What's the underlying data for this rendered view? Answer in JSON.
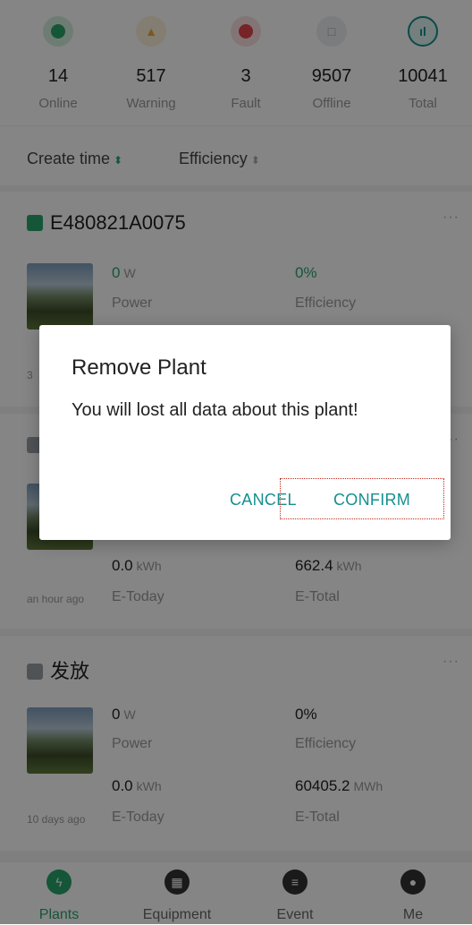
{
  "stats": [
    {
      "value": "14",
      "label": "Online",
      "icon": "check-circle-icon",
      "color": "#2aa56b",
      "glyph": "✓"
    },
    {
      "value": "517",
      "label": "Warning",
      "icon": "warning-triangle-icon",
      "color": "#f2a63a",
      "glyph": "▲"
    },
    {
      "value": "3",
      "label": "Fault",
      "icon": "fault-x-icon",
      "color": "#e2464d",
      "glyph": "✕"
    },
    {
      "value": "9507",
      "label": "Offline",
      "icon": "offline-icon",
      "color": "#9aa0a6",
      "glyph": "□"
    },
    {
      "value": "10041",
      "label": "Total",
      "icon": "chart-icon",
      "color": "#14908f",
      "glyph": "ıl"
    }
  ],
  "sort": {
    "create_time": "Create time",
    "efficiency": "Efficiency",
    "create_time_arrow": "⬍",
    "efficiency_arrow": "⬍"
  },
  "plants": [
    {
      "name": "E480821A0075",
      "more": "···",
      "power_value": "0",
      "power_unit": "W",
      "power_label": "Power",
      "efficiency_value": "0%",
      "efficiency_label": "Efficiency",
      "ago": "3"
    },
    {
      "name": "",
      "more": "···",
      "etoday_value": "0.0",
      "etoday_unit": "kWh",
      "etoday_label": "E-Today",
      "etotal_value": "662.4",
      "etotal_unit": "kWh",
      "etotal_label": "E-Total",
      "ago": "an hour ago"
    },
    {
      "name": "发放",
      "more": "···",
      "power_value": "0",
      "power_unit": "W",
      "power_label": "Power",
      "efficiency_value": "0%",
      "efficiency_label": "Efficiency",
      "etoday_value": "0.0",
      "etoday_unit": "kWh",
      "etoday_label": "E-Today",
      "etotal_value": "60405.2",
      "etotal_unit": "MWh",
      "etotal_label": "E-Total",
      "ago": "10 days ago"
    }
  ],
  "tabs": [
    {
      "label": "Plants",
      "icon": "lightning-icon",
      "glyph": "ϟ"
    },
    {
      "label": "Equipment",
      "icon": "solar-panel-icon",
      "glyph": "▦"
    },
    {
      "label": "Event",
      "icon": "clipboard-icon",
      "glyph": "≡"
    },
    {
      "label": "Me",
      "icon": "user-icon",
      "glyph": "●"
    }
  ],
  "dialog": {
    "title": "Remove Plant",
    "message": "You will lost all data about this plant!",
    "cancel": "CANCEL",
    "confirm": "CONFIRM"
  },
  "colors": {
    "accent": "#2aa56b",
    "dialog_button": "#14908f",
    "highlight_box": "#c0281e"
  }
}
